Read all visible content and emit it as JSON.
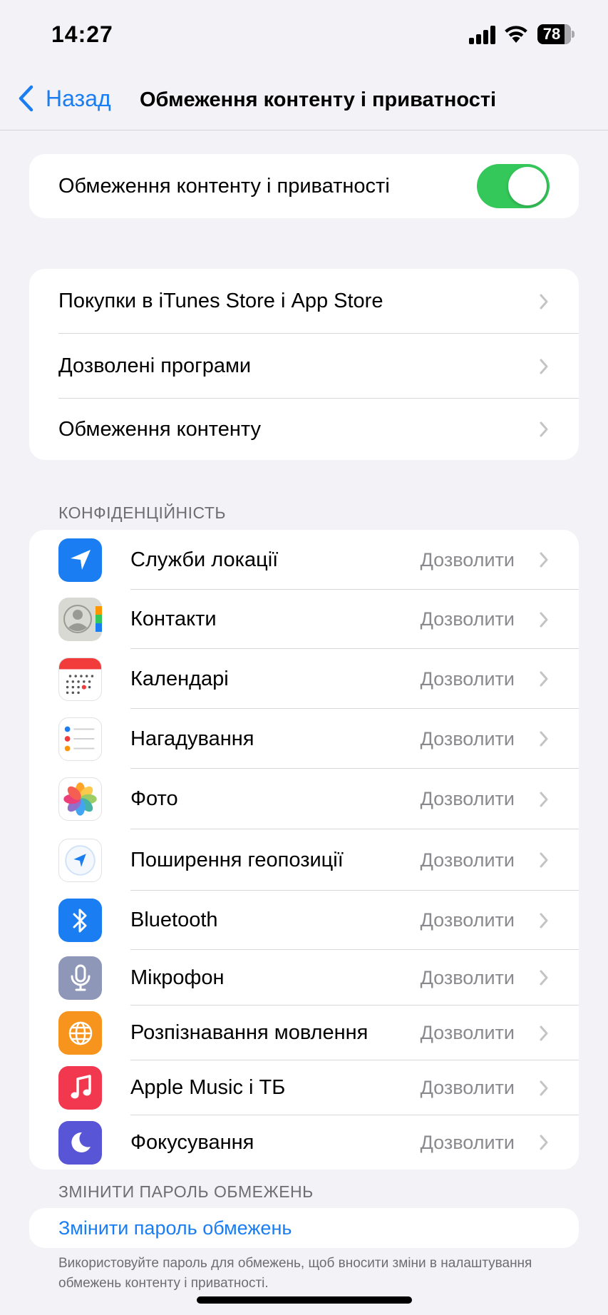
{
  "status_bar": {
    "time": "14:27",
    "battery": "78"
  },
  "nav": {
    "back_label": "Назад",
    "title": "Обмеження контенту і приватності"
  },
  "main_toggle": {
    "label": "Обмеження контенту і приватності",
    "on": true
  },
  "store_group": {
    "items": [
      {
        "label": "Покупки в iTunes Store і App Store"
      },
      {
        "label": "Дозволені програми"
      },
      {
        "label": "Обмеження контенту"
      }
    ]
  },
  "privacy": {
    "header": "КОНФІДЕНЦІЙНІСТЬ",
    "items": [
      {
        "label": "Служби локації",
        "value": "Дозволити",
        "icon": "location-icon"
      },
      {
        "label": "Контакти",
        "value": "Дозволити",
        "icon": "contacts-icon"
      },
      {
        "label": "Календарі",
        "value": "Дозволити",
        "icon": "calendar-icon"
      },
      {
        "label": "Нагадування",
        "value": "Дозволити",
        "icon": "reminders-icon"
      },
      {
        "label": "Фото",
        "value": "Дозволити",
        "icon": "photos-icon"
      },
      {
        "label": "Поширення геопозиції",
        "value": "Дозволити",
        "icon": "share-location-icon"
      },
      {
        "label": "Bluetooth",
        "value": "Дозволити",
        "icon": "bluetooth-icon"
      },
      {
        "label": "Мікрофон",
        "value": "Дозволити",
        "icon": "microphone-icon"
      },
      {
        "label": "Розпізнавання мовлення",
        "value": "Дозволити",
        "icon": "speech-recognition-icon"
      },
      {
        "label": "Apple Music і ТБ",
        "value": "Дозволити",
        "icon": "music-icon"
      },
      {
        "label": "Фокусування",
        "value": "Дозволити",
        "icon": "focus-icon"
      }
    ]
  },
  "passcode": {
    "header": "ЗМІНИТИ ПАРОЛЬ ОБМЕЖЕНЬ",
    "link": "Змінити пароль обмежень",
    "footer": "Використовуйте пароль для обмежень, щоб вносити зміни в налаштування обмежень контенту і приватності."
  },
  "colors": {
    "accent": "#1a7ef2",
    "toggle_on": "#34c759",
    "location": "#1a7ef2",
    "bluetooth": "#1a7ef2",
    "microphone": "#8e97b8",
    "speech": "#f7941d",
    "music": "#f2384f",
    "focus": "#5856d6"
  }
}
